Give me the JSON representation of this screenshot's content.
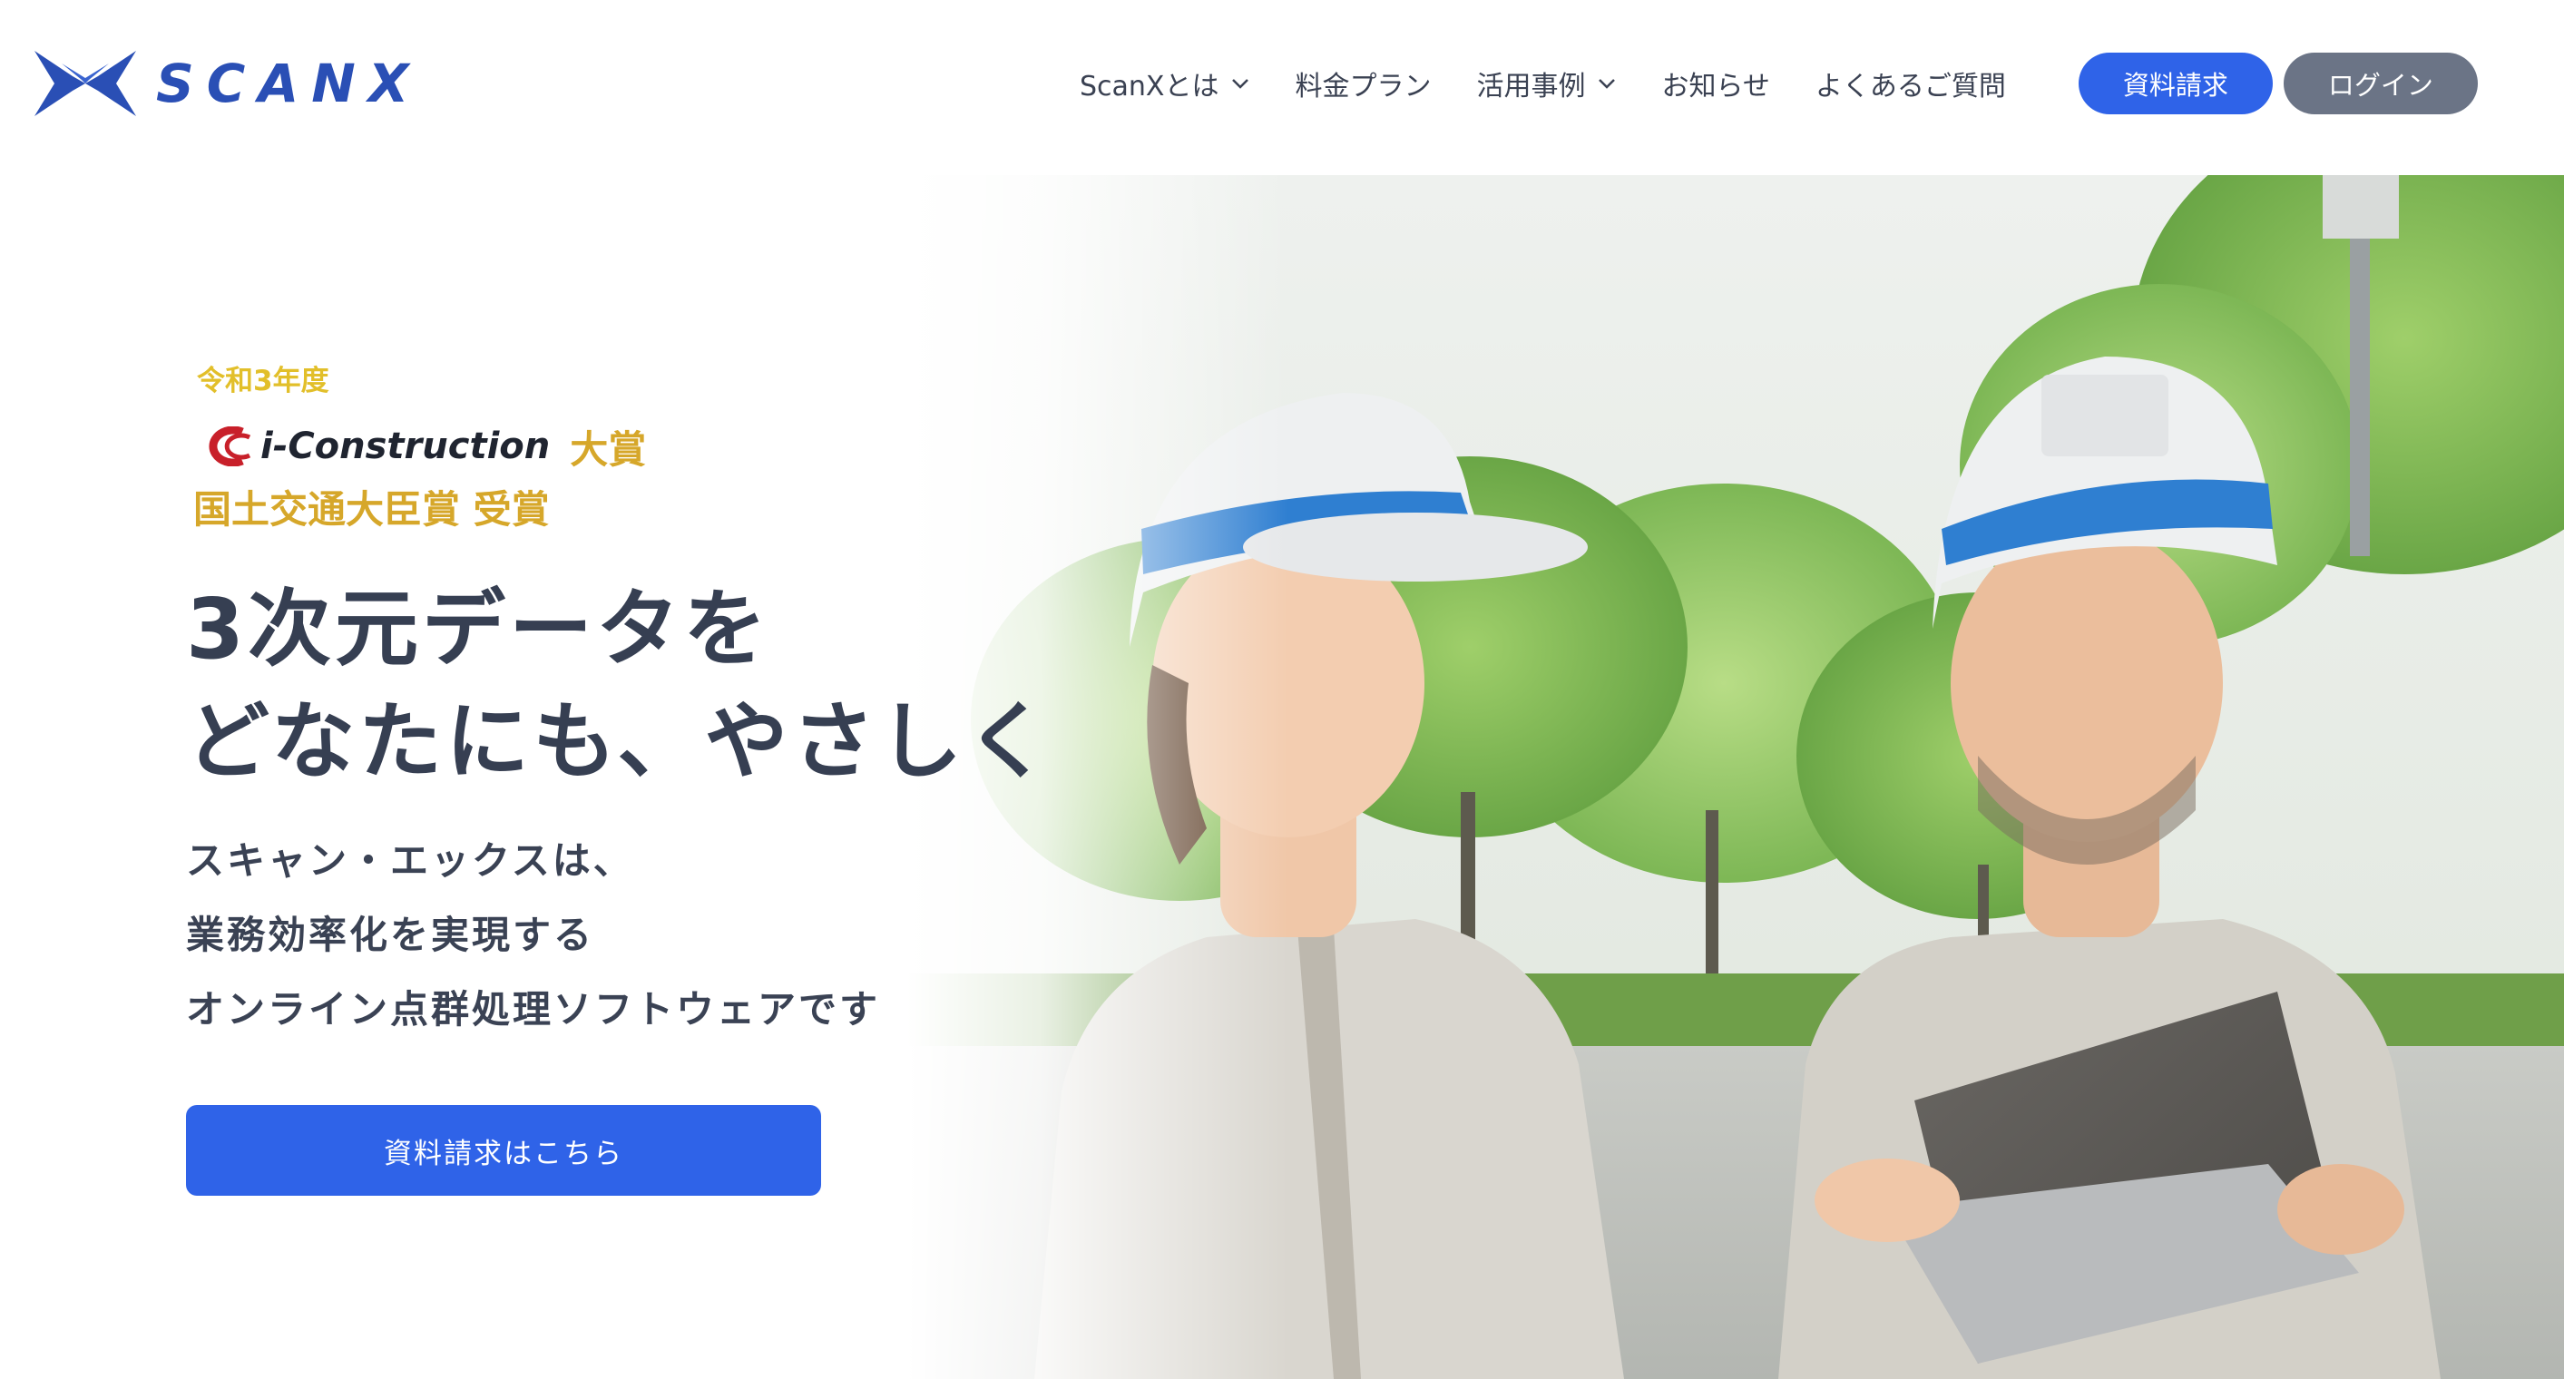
{
  "header": {
    "brand_name": "SCANX",
    "nav": [
      {
        "label": "ScanXとは",
        "has_dropdown": true
      },
      {
        "label": "料金プラン",
        "has_dropdown": false
      },
      {
        "label": "活用事例",
        "has_dropdown": true
      },
      {
        "label": "お知らせ",
        "has_dropdown": false
      },
      {
        "label": "よくあるご質問",
        "has_dropdown": false
      }
    ],
    "request_button": "資料請求",
    "login_button": "ログイン"
  },
  "hero": {
    "award": {
      "year": "令和3年度",
      "program": "i-Construction",
      "grand_prize": "大賞",
      "minister_award": "国土交通大臣賞 受賞"
    },
    "headline": [
      "3次元データを",
      "どなたにも、やさしく"
    ],
    "subtext": [
      "スキャン・エックスは、",
      "業務効率化を実現する",
      "オンライン点群処理ソフトウェアです"
    ],
    "cta_label": "資料請求はこちら"
  },
  "colors": {
    "brand_blue": "#2a4fb5",
    "button_blue": "#2f63e8",
    "login_gray": "#6b7486",
    "award_gold": "#d6a72a",
    "text_dark": "#363f52"
  },
  "icons": {
    "logo": "scanx-x-mark",
    "dropdown": "chevron-down-icon",
    "award_logo": "i-construction-logo"
  }
}
